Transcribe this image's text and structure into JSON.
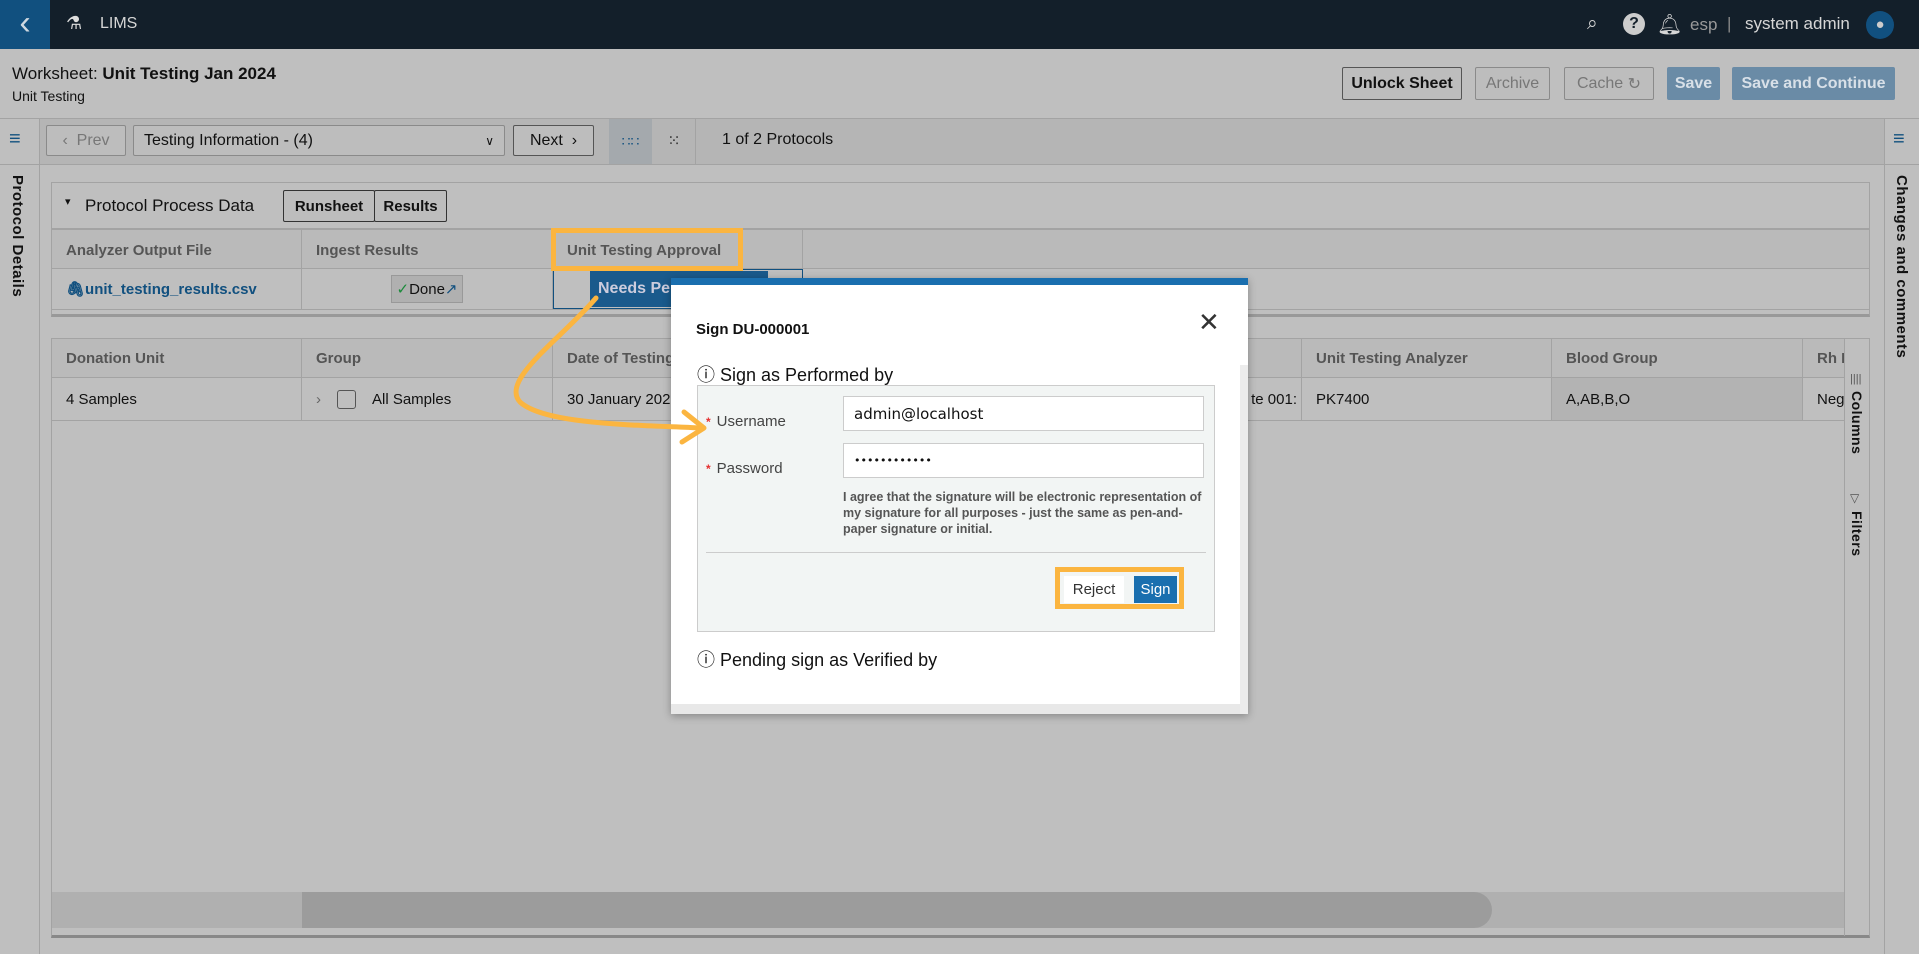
{
  "app": {
    "title": "LIMS",
    "lang": "esp",
    "user": "system admin"
  },
  "header": {
    "worksheet_label": "Worksheet:",
    "worksheet_name": "Unit Testing Jan 2024",
    "subtitle": "Unit Testing",
    "buttons": {
      "unlock": "Unlock Sheet",
      "archive": "Archive",
      "cache": "Cache",
      "save": "Save",
      "save_continue": "Save and Continue"
    }
  },
  "toolbar": {
    "prev": "Prev",
    "select_value": "Testing Information - (4)",
    "next": "Next",
    "protocol_count": "1 of 2 Protocols"
  },
  "sidebars": {
    "left": "Protocol Details",
    "right": "Changes and comments",
    "columns": "Columns",
    "filters": "Filters"
  },
  "panel": {
    "title": "Protocol Process Data",
    "tabs": [
      "Runsheet",
      "Results"
    ],
    "headers": [
      "Analyzer Output File",
      "Ingest Results",
      "Unit Testing Approval"
    ],
    "row": {
      "file": "unit_testing_results.csv",
      "ingest": "Done",
      "approval": "Needs Pe"
    }
  },
  "grid": {
    "headers": [
      "Donation Unit",
      "Group",
      "Date of Testing",
      "Unit Testing Analyzer",
      "Blood Group",
      "Rh I"
    ],
    "row": {
      "donation_unit": "4 Samples",
      "group": "All Samples",
      "date": "30 January 202",
      "partial": "te 001:",
      "analyzer": "PK7400",
      "blood_group": "A,AB,B,O",
      "rh": "Neg"
    }
  },
  "modal": {
    "title": "Sign DU-000001",
    "section1": "Sign as Performed by",
    "username_label": "Username",
    "username_value": "admin@localhost",
    "password_label": "Password",
    "password_value": "••••••••••••",
    "agreement": "I agree that the signature will be electronic representation of my signature for all purposes - just the same as pen-and-paper signature or initial.",
    "reject": "Reject",
    "sign": "Sign",
    "section2": "Pending sign as Verified by"
  },
  "colors": {
    "accent": "#1a6faf",
    "highlight": "#fbb540",
    "topbar": "#131f2a"
  }
}
